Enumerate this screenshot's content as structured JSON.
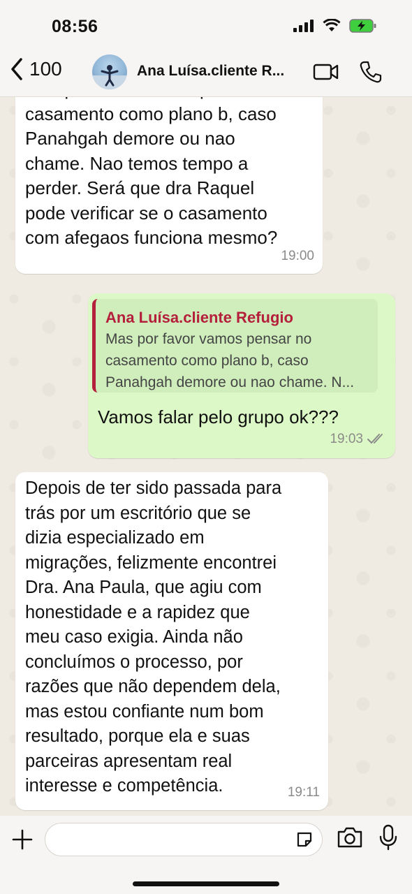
{
  "status_bar": {
    "time": "08:56"
  },
  "header": {
    "back_count": "100",
    "contact_name": "Ana Luísa.cliente R..."
  },
  "messages": [
    {
      "direction": "incoming",
      "text": "Mas por favor vamos pensar no\ncasamento como plano b, caso\nPanahgah demore ou nao\nchame. Nao temos tempo a\nperder.  Será que dra Raquel\npode verificar se o casamento\ncom afegaos funciona mesmo?",
      "time": "19:00"
    },
    {
      "direction": "outgoing",
      "quote": {
        "author": "Ana Luísa.cliente Refugio",
        "text": "Mas por favor vamos pensar no\ncasamento como plano b, caso\nPanahgah demore ou nao chame. N..."
      },
      "text": "Vamos falar pelo grupo ok???",
      "time": "19:03",
      "status": "read"
    },
    {
      "direction": "incoming",
      "text": "Depois de ter sido passada para\ntrás por um escritório que se\ndizia especializado em\nmigrações, felizmente encontrei\nDra. Ana Paula, que agiu com\nhonestidade e a rapidez que\nmeu caso exigia. Ainda não\nconcluímos o processo, por\nrazões que não dependem dela,\nmas estou confiante num bom\nresultado, porque ela e suas\nparceiras apresentam real\ninteresse e competência.",
      "time": "19:11"
    }
  ],
  "composer": {
    "placeholder": ""
  },
  "colors": {
    "outgoing_bubble": "#dcf8c6",
    "incoming_bubble": "#ffffff",
    "quote_author": "#b41f3b",
    "read_check": "#8a8a8a"
  },
  "icons": [
    "back-chevron-icon",
    "video-call-icon",
    "phone-call-icon",
    "plus-icon",
    "sticker-icon",
    "camera-icon",
    "microphone-icon",
    "double-check-icon"
  ]
}
